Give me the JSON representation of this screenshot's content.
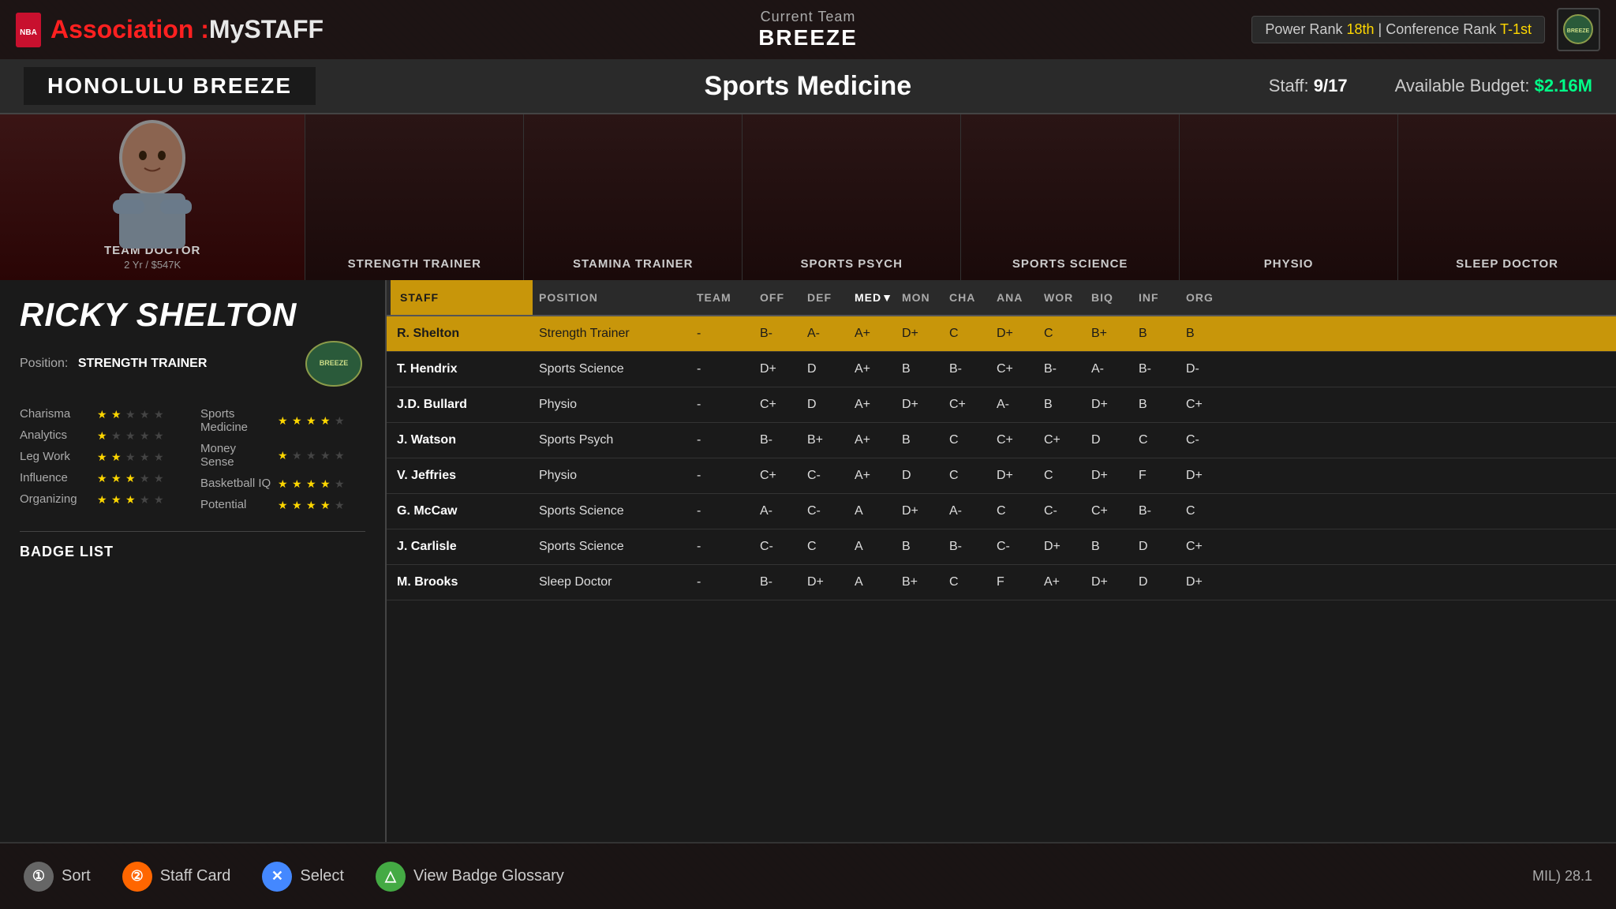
{
  "topbar": {
    "app_name_prefix": "Association :",
    "app_name_suffix": "MySTAFF",
    "current_team_label": "Current Team",
    "current_team_name": "BREEZE",
    "power_rank_label": "Power Rank",
    "power_rank_value": "18th",
    "conference_rank_label": "Conference Rank",
    "conference_rank_value": "T-1st"
  },
  "team_header": {
    "team_name": "HONOLULU BREEZE",
    "section_title": "Sports Medicine",
    "staff_label": "Staff:",
    "staff_current": "9",
    "staff_max": "17",
    "budget_label": "Available Budget:",
    "budget_value": "$2.16M"
  },
  "staff_slots": [
    {
      "id": "slot-doctor",
      "label": "TEAM DOCTOR",
      "sublabel": "2 Yr / $547K",
      "has_person": true
    },
    {
      "id": "slot-strength",
      "label": "STRENGTH TRAINER",
      "sublabel": "",
      "has_person": false
    },
    {
      "id": "slot-stamina",
      "label": "STAMINA TRAINER",
      "sublabel": "",
      "has_person": false
    },
    {
      "id": "slot-psych",
      "label": "SPORTS PSYCH",
      "sublabel": "",
      "has_person": false
    },
    {
      "id": "slot-science",
      "label": "SPORTS SCIENCE",
      "sublabel": "",
      "has_person": false
    },
    {
      "id": "slot-physio",
      "label": "PHYSIO",
      "sublabel": "",
      "has_person": false
    },
    {
      "id": "slot-sleep",
      "label": "SLEEP DOCTOR",
      "sublabel": "",
      "has_person": false
    }
  ],
  "player": {
    "name": "RICKY SHELTON",
    "position_label": "Position:",
    "position_value": "STRENGTH TRAINER",
    "stats": [
      {
        "label": "Charisma",
        "filled": 2,
        "total": 5
      },
      {
        "label": "Analytics",
        "filled": 1,
        "total": 5
      },
      {
        "label": "Leg Work",
        "filled": 2,
        "total": 5
      },
      {
        "label": "Influence",
        "filled": 3,
        "total": 5
      },
      {
        "label": "Organizing",
        "filled": 3,
        "total": 5
      }
    ],
    "secondary_stats": [
      {
        "label": "Sports Medicine",
        "filled": 4,
        "total": 5
      },
      {
        "label": "Money Sense",
        "filled": 1,
        "total": 5
      },
      {
        "label": "Basketball IQ",
        "filled": 4,
        "total": 5
      },
      {
        "label": "Potential",
        "filled": 4,
        "total": 5
      }
    ],
    "badge_section_title": "BADGE LIST"
  },
  "table": {
    "columns": [
      {
        "id": "staff",
        "label": "STAFF"
      },
      {
        "id": "position",
        "label": "POSITION"
      },
      {
        "id": "team",
        "label": "TEAM"
      },
      {
        "id": "off",
        "label": "OFF"
      },
      {
        "id": "def",
        "label": "DEF"
      },
      {
        "id": "med",
        "label": "MED",
        "sort": true
      },
      {
        "id": "mon",
        "label": "MON"
      },
      {
        "id": "cha",
        "label": "CHA"
      },
      {
        "id": "ana",
        "label": "ANA"
      },
      {
        "id": "wor",
        "label": "WOR"
      },
      {
        "id": "biq",
        "label": "BIQ"
      },
      {
        "id": "inf",
        "label": "INF"
      },
      {
        "id": "org",
        "label": "ORG"
      }
    ],
    "rows": [
      {
        "name": "R. Shelton",
        "position": "Strength Trainer",
        "team": "-",
        "off": "B-",
        "def": "A-",
        "med": "A+",
        "mon": "D+",
        "cha": "C",
        "ana": "D+",
        "wor": "C",
        "biq": "B+",
        "inf": "B",
        "org": "B",
        "active": true
      },
      {
        "name": "T. Hendrix",
        "position": "Sports Science",
        "team": "-",
        "off": "D+",
        "def": "D",
        "med": "A+",
        "mon": "B",
        "cha": "B-",
        "ana": "C+",
        "wor": "B-",
        "biq": "A-",
        "inf": "B-",
        "org": "D-",
        "active": false
      },
      {
        "name": "J.D. Bullard",
        "position": "Physio",
        "team": "-",
        "off": "C+",
        "def": "D",
        "med": "A+",
        "mon": "D+",
        "cha": "C+",
        "ana": "A-",
        "wor": "B",
        "biq": "D+",
        "inf": "B",
        "org": "C+",
        "active": false
      },
      {
        "name": "J. Watson",
        "position": "Sports Psych",
        "team": "-",
        "off": "B-",
        "def": "B+",
        "med": "A+",
        "mon": "B",
        "cha": "C",
        "ana": "C+",
        "wor": "C+",
        "biq": "D",
        "inf": "C",
        "org": "C-",
        "active": false
      },
      {
        "name": "V. Jeffries",
        "position": "Physio",
        "team": "-",
        "off": "C+",
        "def": "C-",
        "med": "A+",
        "mon": "D",
        "cha": "C",
        "ana": "D+",
        "wor": "C",
        "biq": "D+",
        "inf": "F",
        "org": "D+",
        "active": false
      },
      {
        "name": "G. McCaw",
        "position": "Sports Science",
        "team": "-",
        "off": "A-",
        "def": "C-",
        "med": "A",
        "mon": "D+",
        "cha": "A-",
        "ana": "C",
        "wor": "C-",
        "biq": "C+",
        "inf": "B-",
        "org": "C",
        "active": false
      },
      {
        "name": "J. Carlisle",
        "position": "Sports Science",
        "team": "-",
        "off": "C-",
        "def": "C",
        "med": "A",
        "mon": "B",
        "cha": "B-",
        "ana": "C-",
        "wor": "D+",
        "biq": "B",
        "inf": "D",
        "org": "C+",
        "active": false
      },
      {
        "name": "M. Brooks",
        "position": "Sleep Doctor",
        "team": "-",
        "off": "B-",
        "def": "D+",
        "med": "A",
        "mon": "B+",
        "cha": "C",
        "ana": "F",
        "wor": "A+",
        "biq": "D+",
        "inf": "D",
        "org": "D+",
        "active": false
      }
    ]
  },
  "bottom_bar": {
    "actions": [
      {
        "id": "sort",
        "icon": "①",
        "label": "Sort",
        "color": "gray"
      },
      {
        "id": "staff-card",
        "icon": "②",
        "label": "Staff Card",
        "color": "orange"
      },
      {
        "id": "select",
        "icon": "✕",
        "label": "Select",
        "color": "blue"
      },
      {
        "id": "badge-glossary",
        "icon": "△",
        "label": "View Badge Glossary",
        "color": "green"
      }
    ],
    "status_text": "MIL) 28.1"
  }
}
